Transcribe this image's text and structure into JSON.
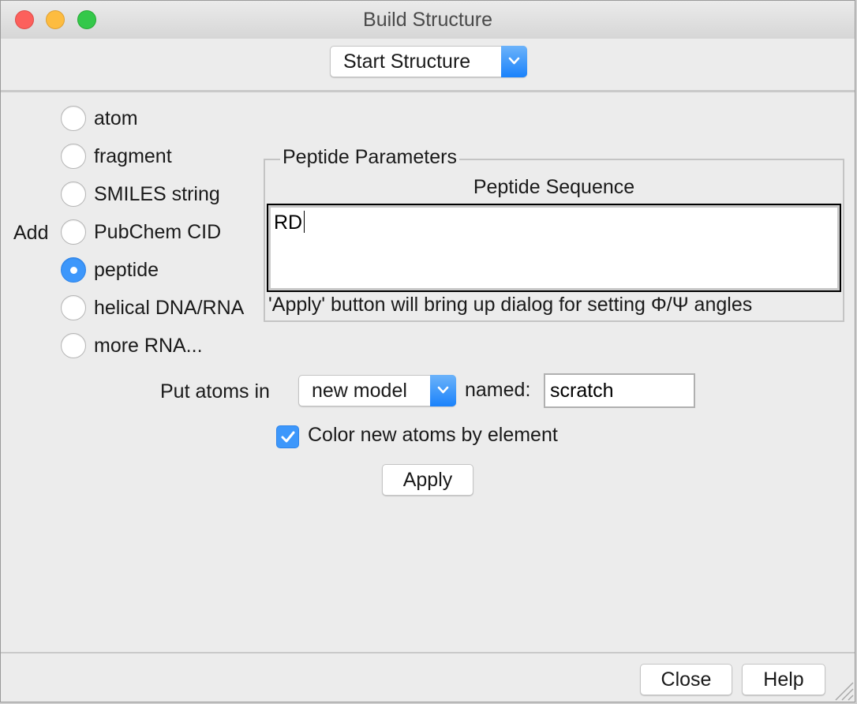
{
  "window": {
    "title": "Build Structure"
  },
  "toolbar": {
    "mode_selected": "Start Structure"
  },
  "add_section": {
    "add_label": "Add",
    "options": [
      {
        "label": "atom",
        "selected": false
      },
      {
        "label": "fragment",
        "selected": false
      },
      {
        "label": "SMILES string",
        "selected": false
      },
      {
        "label": "PubChem CID",
        "selected": false
      },
      {
        "label": "peptide",
        "selected": true
      },
      {
        "label": "helical DNA/RNA",
        "selected": false
      },
      {
        "label": "more RNA...",
        "selected": false
      }
    ]
  },
  "peptide_parameters": {
    "group_title": "Peptide Parameters",
    "sequence_label": "Peptide Sequence",
    "sequence_value": "RD",
    "hint": "'Apply' button will bring up dialog for setting Φ/Ψ angles"
  },
  "placement": {
    "put_atoms_label": "Put atoms in",
    "model_selected": "new model",
    "named_label": "named:",
    "name_value": "scratch"
  },
  "color_option": {
    "label": "Color new atoms by element",
    "checked": true
  },
  "buttons": {
    "apply": "Apply",
    "close": "Close",
    "help": "Help"
  },
  "colors": {
    "accent": "#3d97fb",
    "close_light": "#fc605c",
    "minimize_light": "#fdbc40",
    "zoom_light": "#34c84a"
  }
}
